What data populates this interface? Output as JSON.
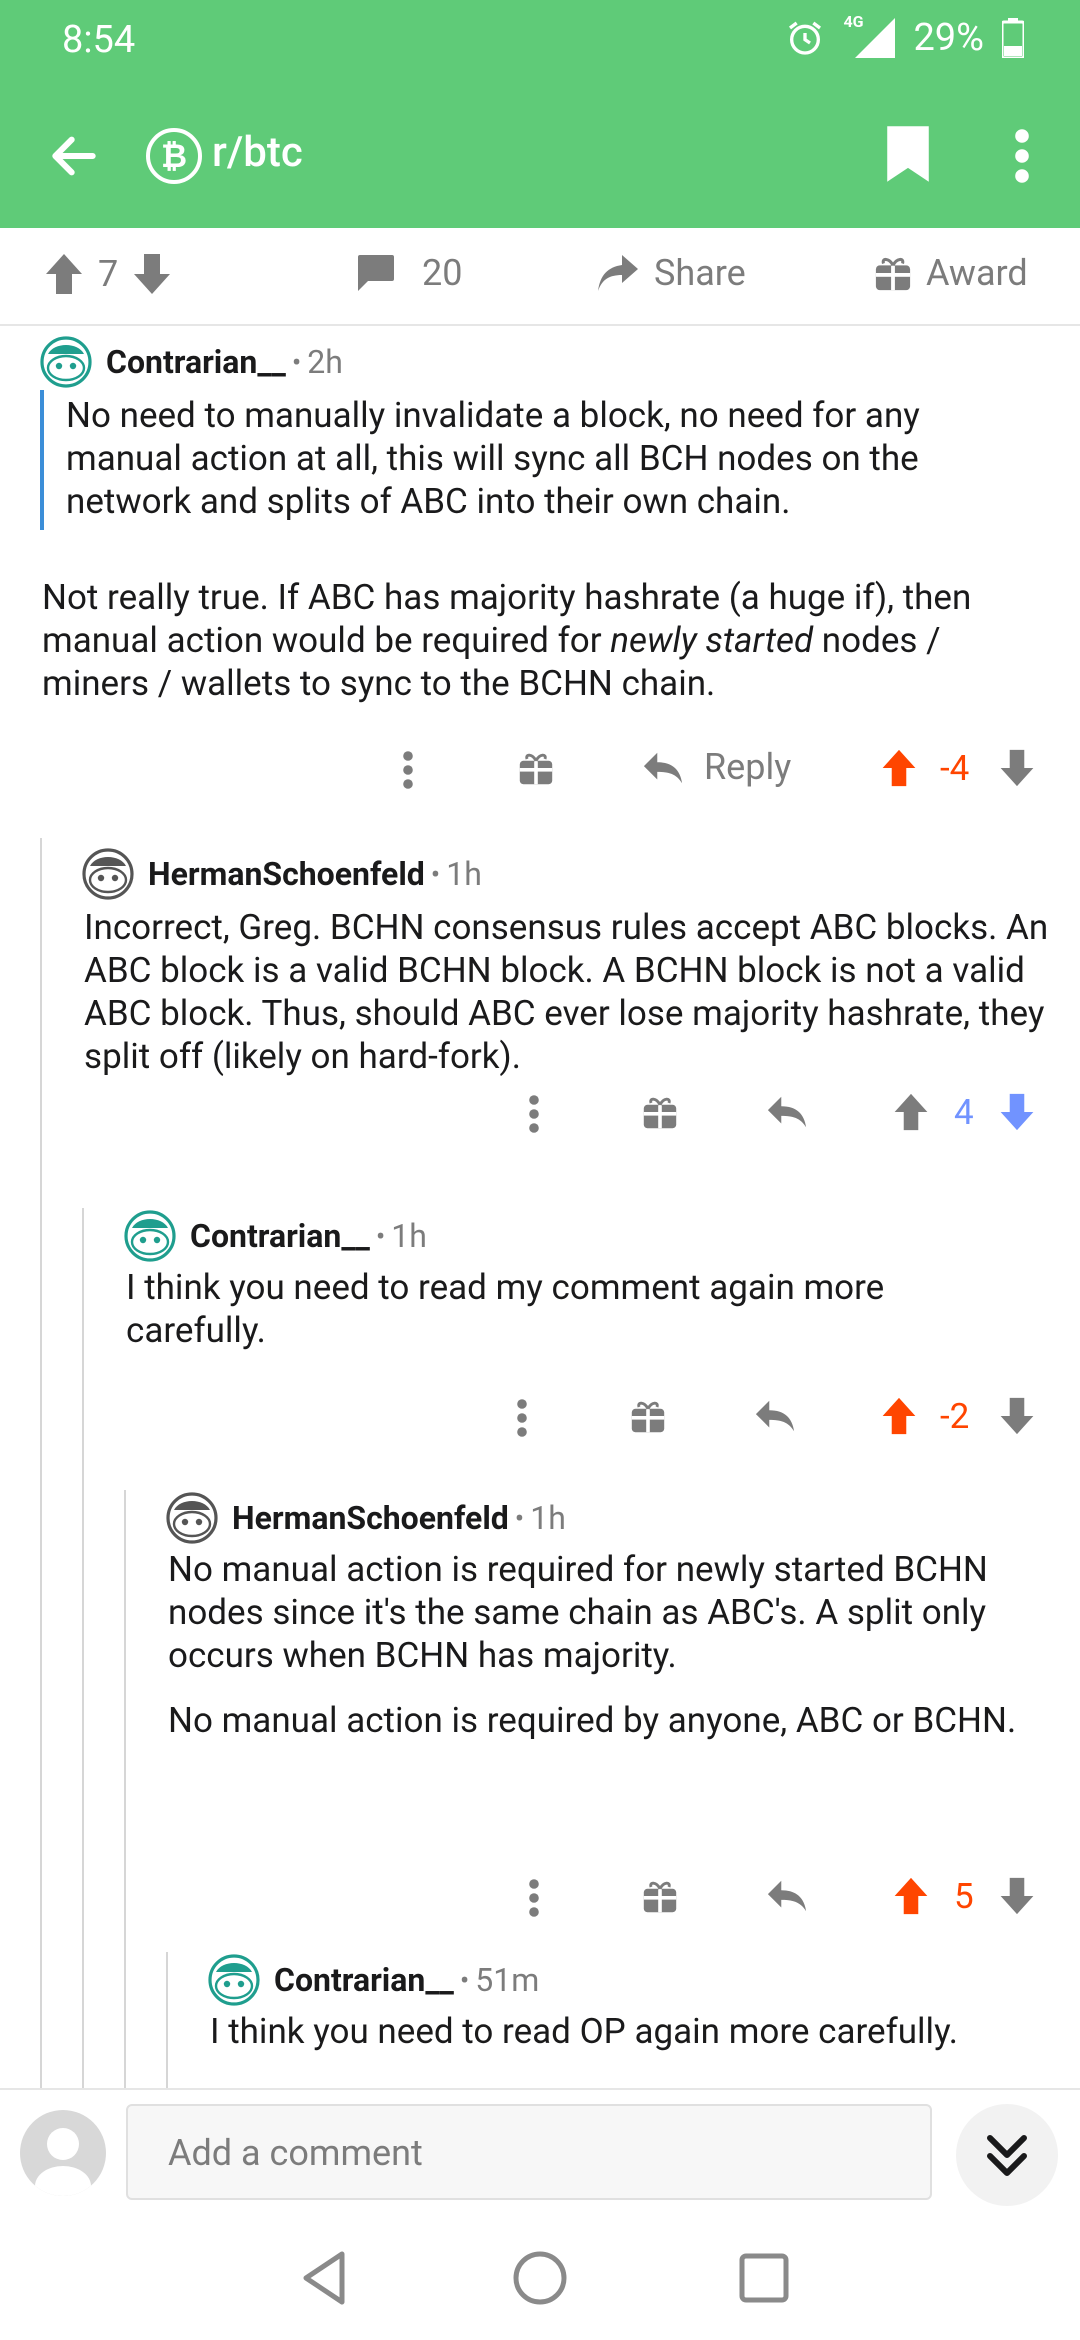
{
  "status": {
    "time": "8:54",
    "network": "4G",
    "battery": "29%"
  },
  "header": {
    "subreddit": "r/btc",
    "sub_icon_letter": "₿"
  },
  "post_actions": {
    "upvotes": "7",
    "comments": "20",
    "share": "Share",
    "award": "Award"
  },
  "comments": [
    {
      "author": "Contrarian__",
      "age": "2h",
      "quote": "No need to manually invalidate a block, no need for any manual action at all, this will sync all BCH nodes on the network and splits of ABC into their own chain.",
      "para_pre": "Not really true. If ABC has majority hashrate (a huge if), then manual action would be required for ",
      "para_em": "newly started",
      "para_post": " nodes / miners / wallets to sync to the BCHN chain.",
      "reply": "Reply",
      "score": "-4",
      "vote": "up"
    },
    {
      "author": "HermanSchoenfeld",
      "age": "1h",
      "text": "Incorrect, Greg. BCHN consensus rules accept ABC blocks. An ABC block is a valid BCHN block. A BCHN block is not a valid ABC block. Thus, should ABC ever lose majority hashrate, they split off (likely on hard-fork).",
      "score": "4",
      "vote": "down"
    },
    {
      "author": "Contrarian__",
      "age": "1h",
      "text": "I think you need to read my comment again more carefully.",
      "score": "-2",
      "vote": "up"
    },
    {
      "author": "HermanSchoenfeld",
      "age": "1h",
      "text": "No manual action is required for newly started BCHN nodes since it's the same chain as ABC's. A split only occurs when BCHN has majority.",
      "text2": "No manual action is required by anyone, ABC or BCHN.",
      "score": "5",
      "vote": "up"
    },
    {
      "author": "Contrarian__",
      "age": "51m",
      "text": "I think you need to read OP again more carefully."
    }
  ],
  "composer": {
    "placeholder": "Add a comment"
  },
  "colors": {
    "header": "#5fcb78",
    "upvote": "#ff4500",
    "downvote": "#7193ff",
    "quote_bar": "#3b8ed8"
  }
}
